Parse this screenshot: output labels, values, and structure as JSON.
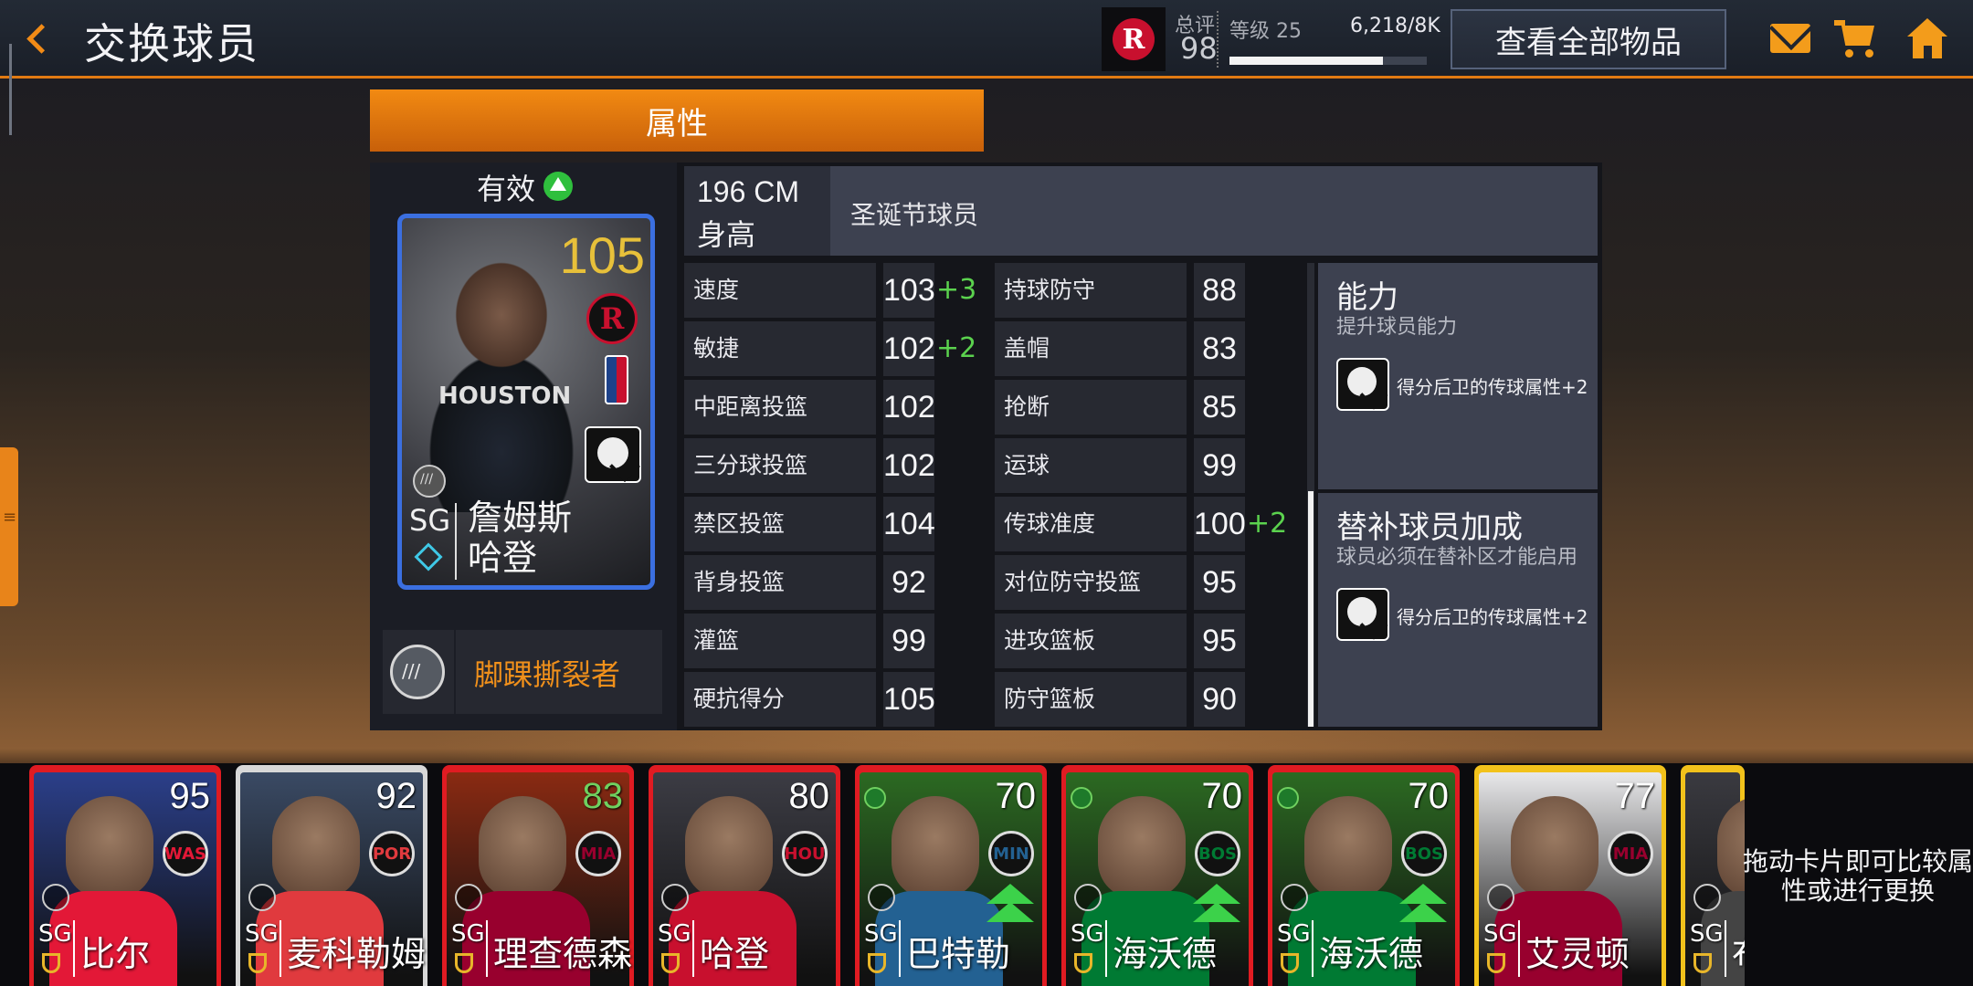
{
  "header": {
    "title": "交换球员",
    "overall_label": "总评",
    "overall_value": "98",
    "level_label": "等级 25",
    "xp_label": "6,218/8K",
    "xp_progress": 0.78,
    "view_all_label": "查看全部物品",
    "icons": [
      "back-icon",
      "mail-icon",
      "cart-icon",
      "home-icon"
    ]
  },
  "section_tab": "属性",
  "player": {
    "status": "有效",
    "rating": "105",
    "jersey_text": "HOUSTON",
    "position": "SG",
    "name": "詹姆斯\n哈登",
    "trait": "脚踝撕裂者",
    "height": "196 CM",
    "height_label": "身高",
    "tag": "圣诞节球员"
  },
  "stats_left": [
    {
      "label": "速度",
      "value": "103",
      "bonus": "+3"
    },
    {
      "label": "敏捷",
      "value": "102",
      "bonus": "+2"
    },
    {
      "label": "中距离投篮",
      "value": "102",
      "bonus": ""
    },
    {
      "label": "三分球投篮",
      "value": "102",
      "bonus": ""
    },
    {
      "label": "禁区投篮",
      "value": "104",
      "bonus": ""
    },
    {
      "label": "背身投篮",
      "value": "92",
      "bonus": ""
    },
    {
      "label": "灌篮",
      "value": "99",
      "bonus": ""
    },
    {
      "label": "硬抗得分",
      "value": "105",
      "bonus": ""
    }
  ],
  "stats_right": [
    {
      "label": "持球防守",
      "value": "88",
      "bonus": ""
    },
    {
      "label": "盖帽",
      "value": "83",
      "bonus": ""
    },
    {
      "label": "抢断",
      "value": "85",
      "bonus": ""
    },
    {
      "label": "运球",
      "value": "99",
      "bonus": ""
    },
    {
      "label": "传球准度",
      "value": "100",
      "bonus": "+2"
    },
    {
      "label": "对位防守投篮",
      "value": "95",
      "bonus": ""
    },
    {
      "label": "进攻篮板",
      "value": "95",
      "bonus": ""
    },
    {
      "label": "防守篮板",
      "value": "90",
      "bonus": ""
    }
  ],
  "abilities": [
    {
      "title": "能力",
      "desc": "提升球员能力",
      "effect": "得分后卫的传球属性+2"
    },
    {
      "title": "替补球员加成",
      "desc": "球员必须在替补区才能启用",
      "effect": "得分后卫的传球属性+2"
    }
  ],
  "tray": {
    "hint": "拖动卡片即可比较属性或进行更换",
    "cards": [
      {
        "rating": "95",
        "pos": "SG",
        "name": "比尔",
        "border": "#e01b22",
        "art": "#2b3f8a",
        "team": "WAS",
        "team_color": "#e31837"
      },
      {
        "rating": "92",
        "pos": "SG",
        "name": "麦科勒姆",
        "border": "#d8d8d8",
        "art": "#3a4a64",
        "team": "POR",
        "team_color": "#e03a3e"
      },
      {
        "rating": "83",
        "pos": "SG",
        "name": "理查德森",
        "border": "#e01b22",
        "art": "#8a2a12",
        "team": "MIA",
        "team_color": "#98002e"
      },
      {
        "rating": "80",
        "pos": "SG",
        "name": "哈登",
        "border": "#e01b22",
        "art": "#3c3c44",
        "team": "HOU",
        "team_color": "#c8102e"
      },
      {
        "rating": "70",
        "pos": "SG",
        "name": "巴特勒",
        "border": "#e01b22",
        "art": "#2c6a22",
        "team": "MIN",
        "team_color": "#236192"
      },
      {
        "rating": "70",
        "pos": "SG",
        "name": "海沃德",
        "border": "#e01b22",
        "art": "#2c6a22",
        "team": "BOS",
        "team_color": "#007a33"
      },
      {
        "rating": "70",
        "pos": "SG",
        "name": "海沃德",
        "border": "#e01b22",
        "art": "#2c6a22",
        "team": "BOS",
        "team_color": "#007a33"
      },
      {
        "rating": "77",
        "pos": "SG",
        "name": "艾灵顿",
        "border": "#f2c21b",
        "art": "#e8e8ea",
        "team": "MIA",
        "team_color": "#98002e"
      },
      {
        "rating": "",
        "pos": "SG",
        "name": "布",
        "border": "#f2c21b",
        "art": "#3a3a40",
        "team": "",
        "team_color": "#444"
      }
    ]
  },
  "colors": {
    "accent": "#f28a12",
    "bonus": "#5bd24e",
    "card_border": "#3b6fe0",
    "rating_gold": "#e7c03a"
  }
}
